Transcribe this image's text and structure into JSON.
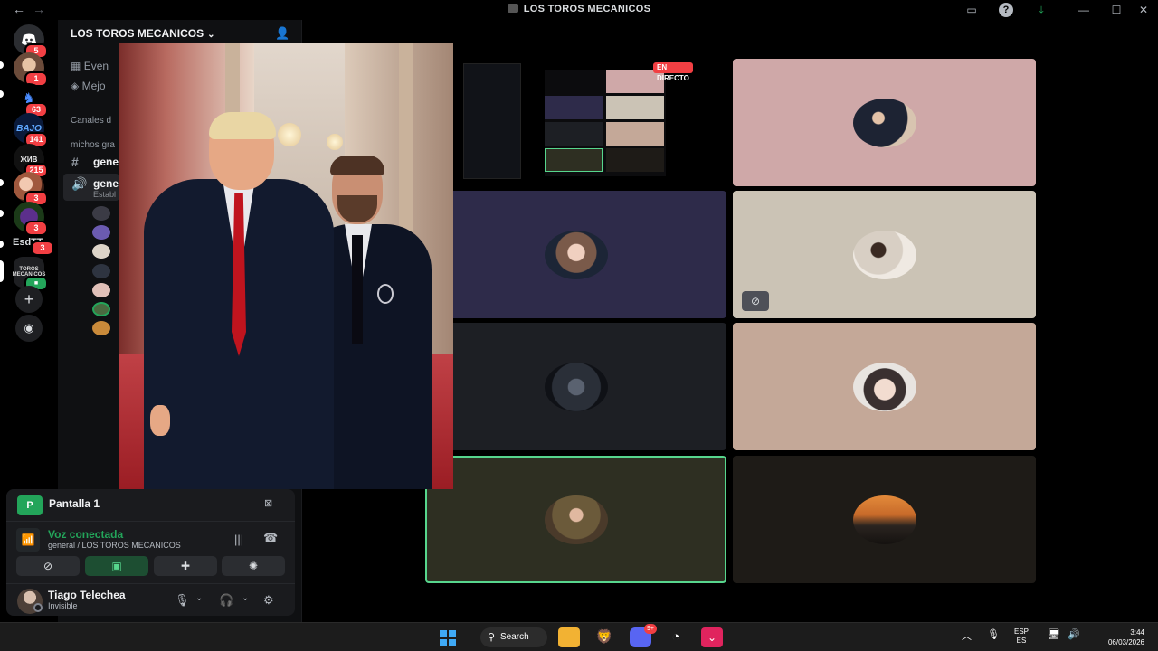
{
  "window": {
    "title": "LOS TOROS MECANICOS",
    "nav_back": "←",
    "nav_forward": "→"
  },
  "guilds": [
    {
      "name": "home",
      "badge": "5"
    },
    {
      "name": "g1",
      "badge": "1"
    },
    {
      "name": "g2",
      "badge": "63"
    },
    {
      "name": "g3",
      "badge": "141"
    },
    {
      "name": "g4",
      "badge": "215"
    },
    {
      "name": "g5",
      "badge": "3"
    },
    {
      "name": "g6",
      "badge": "3"
    },
    {
      "name": "EsdTT",
      "badge": "3"
    },
    {
      "name": "toros",
      "badge": ""
    }
  ],
  "channels": {
    "server_name": "LOS TOROS MECANICOS",
    "events_label": "Even",
    "boost_label": "Mejo",
    "category_1": "Canales d",
    "category_2": "michos gra",
    "text_channel": "gene",
    "voice_channel": "gene",
    "voice_sub": "Establ"
  },
  "stream": {
    "live_label": "EN DIRECTO"
  },
  "voice_panel": {
    "screen_icon": "P",
    "screen_title": "Pantalla 1",
    "status_title": "Voz conectada",
    "status_sub": "general / LOS TOROS MECANICOS"
  },
  "user": {
    "name": "Tiago Telechea",
    "status": "Invisible"
  },
  "taskbar": {
    "search_label": "Search",
    "discord_badge": "9+",
    "lang_top": "ESP",
    "lang_bottom": "ES",
    "time": "3:44",
    "date": "06/03/2026"
  },
  "colors": {
    "accent_green": "#23a55a",
    "badge_red": "#f23f43",
    "tile_pink": "#cfa8a8",
    "tile_purple": "#2e2b4a",
    "tile_beige": "#cbc3b5",
    "tile_dark": "#1d1f24",
    "tile_tan": "#c4a898"
  }
}
